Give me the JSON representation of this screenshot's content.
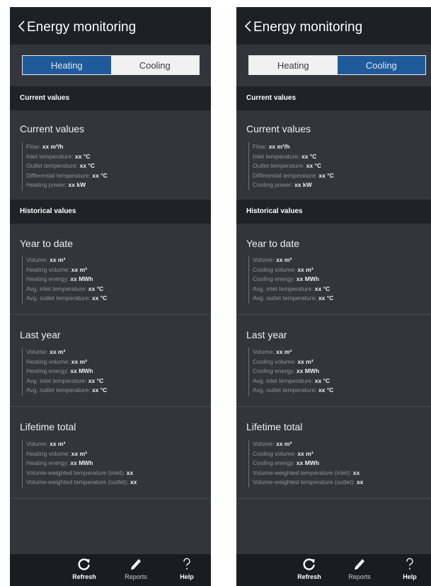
{
  "screens": [
    {
      "title": "Energy monitoring",
      "mode": {
        "options": [
          "Heating",
          "Cooling"
        ],
        "selected": "Heating"
      },
      "current_section": "Current values",
      "current_heading": "Current values",
      "current_rows": [
        {
          "label": "Flow:",
          "value": "xx m³/h"
        },
        {
          "label": "Inlet temperature:",
          "value": "xx °C"
        },
        {
          "label": "Outlet temperature:",
          "value": "xx °C"
        },
        {
          "label": "Differential temperature:",
          "value": "xx °C"
        },
        {
          "label": "Heating power:",
          "value": "xx kW"
        }
      ],
      "historical_section": "Historical values",
      "year_to_date": {
        "heading": "Year to date",
        "rows": [
          {
            "label": "Volume:",
            "value": "xx m³"
          },
          {
            "label": "Heating volume:",
            "value": "xx m³"
          },
          {
            "label": "Heating energy:",
            "value": "xx MWh"
          },
          {
            "label": "Avg. inlet temperature:",
            "value": "xx °C"
          },
          {
            "label": "Avg. outlet temperature:",
            "value": "xx °C"
          }
        ]
      },
      "last_year": {
        "heading": "Last year",
        "rows": [
          {
            "label": "Volume:",
            "value": "xx m³"
          },
          {
            "label": "Heating volume:",
            "value": "xx m³"
          },
          {
            "label": "Heating energy:",
            "value": "xx MWh"
          },
          {
            "label": "Avg. inlet temperature:",
            "value": "xx °C"
          },
          {
            "label": "Avg. outlet temperature:",
            "value": "xx °C"
          }
        ]
      },
      "lifetime_total": {
        "heading": "Lifetime total",
        "rows": [
          {
            "label": "Volume:",
            "value": "xx m³"
          },
          {
            "label": "Heating volume:",
            "value": "xx m³"
          },
          {
            "label": "Heating energy:",
            "value": "xx MWh"
          },
          {
            "label": "Volume-weighted temperature (inlet):",
            "value": "xx"
          },
          {
            "label": "Volume-weighted temperature (outlet):",
            "value": "xx"
          }
        ]
      },
      "tabs": {
        "refresh": "Refresh",
        "reports": "Reports",
        "help": "Help"
      }
    },
    {
      "title": "Energy monitoring",
      "mode": {
        "options": [
          "Heating",
          "Cooling"
        ],
        "selected": "Cooling"
      },
      "current_section": "Current values",
      "current_heading": "Current values",
      "current_rows": [
        {
          "label": "Flow:",
          "value": "xx m³/h"
        },
        {
          "label": "Inlet temperature:",
          "value": "xx °C"
        },
        {
          "label": "Outlet temperature:",
          "value": "xx °C"
        },
        {
          "label": "Differential temperature:",
          "value": "xx °C"
        },
        {
          "label": "Cooling power:",
          "value": "xx kW"
        }
      ],
      "historical_section": "Historical values",
      "year_to_date": {
        "heading": "Year to date",
        "rows": [
          {
            "label": "Volume:",
            "value": "xx m³"
          },
          {
            "label": "Cooling volume:",
            "value": "xx m³"
          },
          {
            "label": "Cooling energy:",
            "value": "xx MWh"
          },
          {
            "label": "Avg. inlet temperature:",
            "value": "xx °C"
          },
          {
            "label": "Avg. outlet temperature:",
            "value": "xx °C"
          }
        ]
      },
      "last_year": {
        "heading": "Last year",
        "rows": [
          {
            "label": "Volume:",
            "value": "xx m³"
          },
          {
            "label": "Cooling volume:",
            "value": "xx m³"
          },
          {
            "label": "Cooling energy:",
            "value": "xx MWh"
          },
          {
            "label": "Avg. inlet temperature:",
            "value": "xx °C"
          },
          {
            "label": "Avg. outlet temperature:",
            "value": "xx °C"
          }
        ]
      },
      "lifetime_total": {
        "heading": "Lifetime total",
        "rows": [
          {
            "label": "Volume:",
            "value": "xx m³"
          },
          {
            "label": "Cooling volume:",
            "value": "xx m³"
          },
          {
            "label": "Cooling energy:",
            "value": "xx MWh"
          },
          {
            "label": "Volume-weighted temperature (inlet):",
            "value": "xx"
          },
          {
            "label": "Volume-weighted temperature (outlet):",
            "value": "xx"
          }
        ]
      },
      "tabs": {
        "refresh": "Refresh",
        "reports": "Reports",
        "help": "Help"
      }
    }
  ]
}
